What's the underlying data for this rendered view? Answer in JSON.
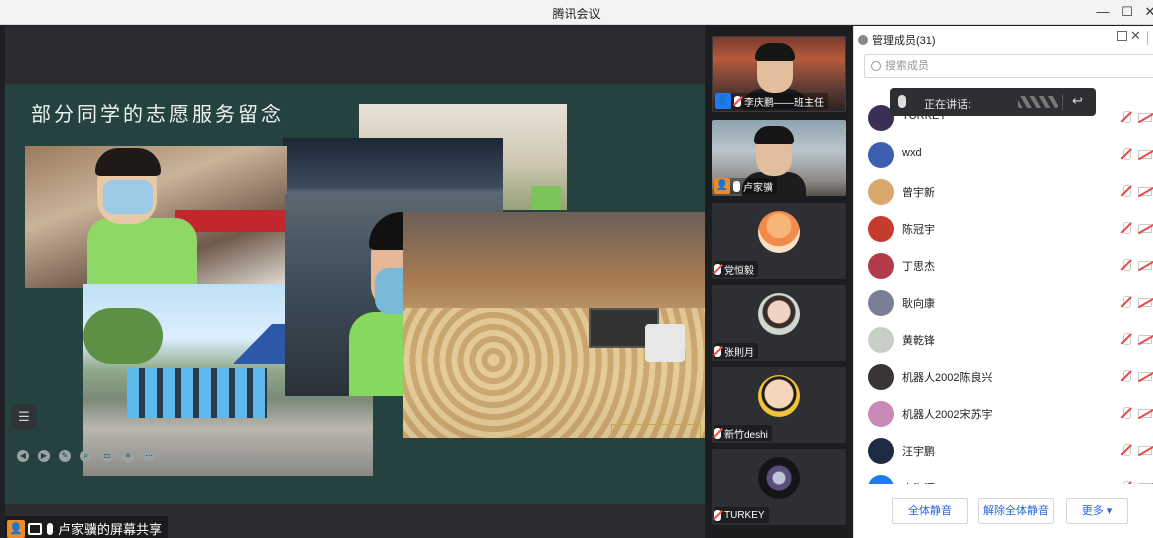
{
  "window": {
    "title": "腾讯会议",
    "min": "—",
    "max": "☐",
    "close": "✕"
  },
  "slide": {
    "title": "部分同学的志愿服务留念",
    "menu_icon": "☰"
  },
  "share": {
    "label": "卢家骥的屏幕共享"
  },
  "video_tiles": [
    {
      "name": "李庆鹏——班主任",
      "badge": "blue"
    },
    {
      "name": "卢家骥",
      "badge": "orange"
    },
    {
      "name": "党恒毅"
    },
    {
      "name": "张則月"
    },
    {
      "name": "新竹deshi"
    },
    {
      "name": "TURKEY"
    }
  ],
  "members_panel": {
    "title": "管理成员(31)",
    "search_placeholder": "搜索成员",
    "speaking_label": "正在讲话:",
    "members": [
      {
        "name": "TURKEY",
        "avatar_color": "#3b2f56"
      },
      {
        "name": "wxd",
        "avatar_color": "#3c5fb0"
      },
      {
        "name": "曾宇新",
        "avatar_color": "#d9a86b"
      },
      {
        "name": "陈冠宇",
        "avatar_color": "#c73a2e"
      },
      {
        "name": "丁思杰",
        "avatar_color": "#b23b4a"
      },
      {
        "name": "耿向康",
        "avatar_color": "#7b7f95"
      },
      {
        "name": "黄乾锋",
        "avatar_color": "#c7cfc7"
      },
      {
        "name": "机器人2002陈良兴",
        "avatar_color": "#3a3436"
      },
      {
        "name": "机器人2002宋苏宇",
        "avatar_color": "#c98ab6"
      },
      {
        "name": "汪宇鹏",
        "avatar_color": "#1f2a44"
      },
      {
        "name": "李海源",
        "avatar_color": "#1f7af0"
      }
    ],
    "buttons": {
      "mute_all": "全体静音",
      "unmute_all": "解除全体静音",
      "more": "更多 ▾"
    }
  }
}
